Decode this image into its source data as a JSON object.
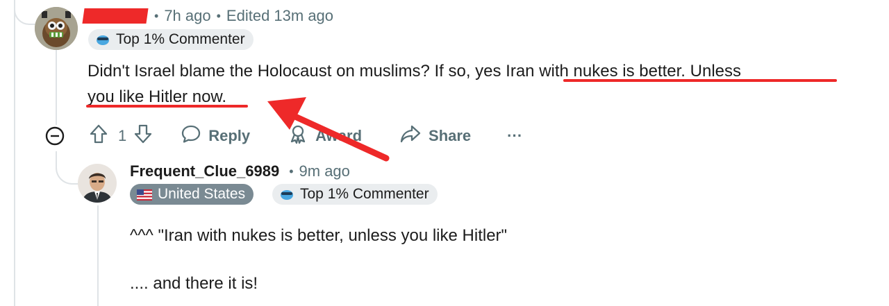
{
  "comment": {
    "meta": {
      "time": "7h ago",
      "edited": "Edited 13m ago"
    },
    "flair": "Top 1% Commenter",
    "text_part1": "Didn't Israel blame the Holocaust on muslims? If so, yes ",
    "text_highlight1": "Iran with nukes is better. Unless",
    "text_highlight2": "you like Hitler now.",
    "actions": {
      "vote_count": "1",
      "reply": "Reply",
      "award": "Award",
      "share": "Share",
      "more": "···"
    }
  },
  "reply": {
    "username": "Frequent_Clue_6989",
    "time": "9m ago",
    "flairs": {
      "country": "United States",
      "commenter": "Top 1% Commenter"
    },
    "line1": "^^^ \"Iran with nukes is better, unless you like Hitler\"",
    "line2": ".... and there it is!"
  },
  "colors": {
    "annotation": "#ee2929",
    "meta": "#576f76",
    "thread": "#dfe3e6"
  }
}
